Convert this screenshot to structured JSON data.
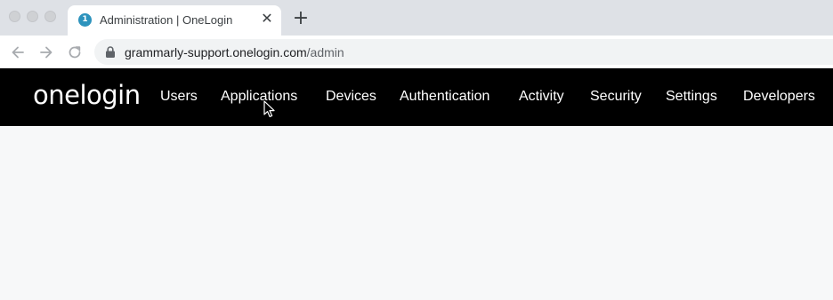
{
  "browser": {
    "tab": {
      "favicon_text": "1",
      "title": "Administration | OneLogin",
      "close_glyph": "✕"
    },
    "new_tab_glyph": "+",
    "url": {
      "host": "grammarly-support.onelogin.com",
      "path": "/admin"
    }
  },
  "app": {
    "logo": "onelogin",
    "nav": [
      {
        "label": "Users"
      },
      {
        "label": "Applications"
      },
      {
        "label": "Devices"
      },
      {
        "label": "Authentication"
      },
      {
        "label": "Activity"
      },
      {
        "label": "Security"
      },
      {
        "label": "Settings"
      },
      {
        "label": "Developers"
      }
    ]
  },
  "colors": {
    "navbar_bg": "#000000",
    "favicon_bg": "#2d93bd",
    "content_bg": "#f7f8f9"
  }
}
